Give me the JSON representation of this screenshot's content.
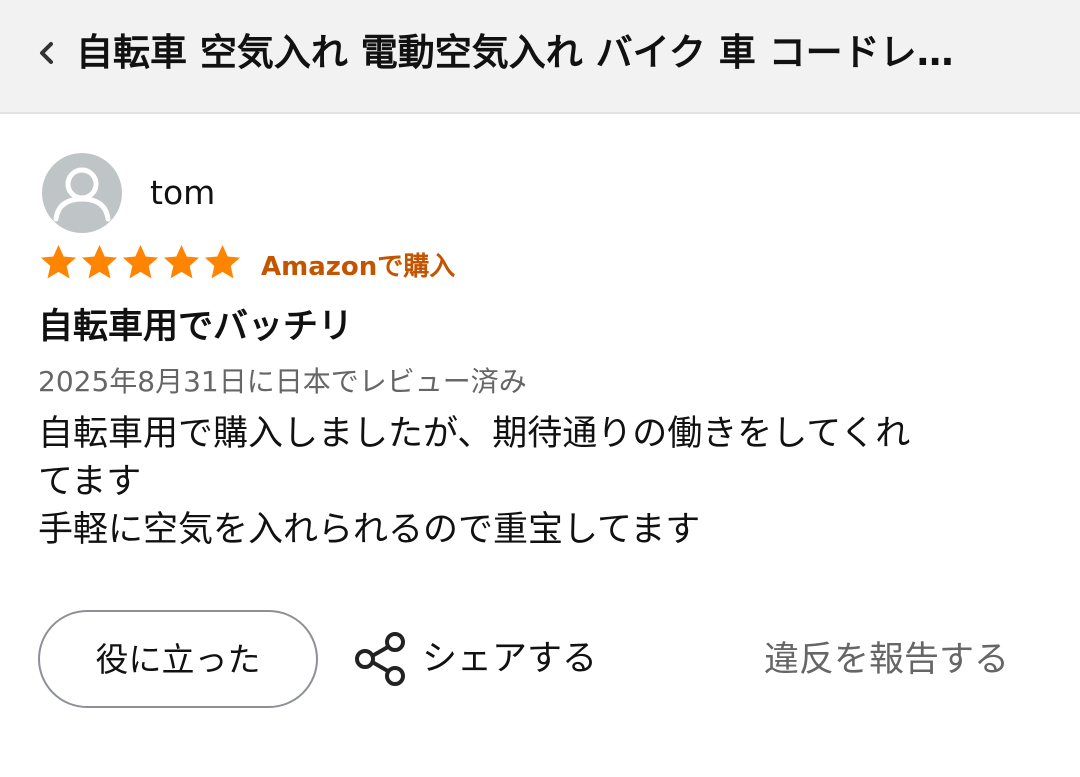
{
  "header": {
    "back_icon": "chevron-left-icon",
    "title": "自転車 空気入れ 電動空気入れ バイク 車 コードレ…"
  },
  "review": {
    "avatar_icon": "user-avatar-icon",
    "reviewer_name": "tom",
    "rating": 5,
    "rating_max": 5,
    "star_color": "#ff8400",
    "verified_label": "Amazonで購入",
    "verified_color": "#c45500",
    "title": "自転車用でバッチリ",
    "date_line": "2025年8月31日に日本でレビュー済み",
    "body_lines": [
      "自転車用で購入しましたが、期待通りの働きをしてくれ",
      "てます",
      "手軽に空気を入れられるので重宝してます"
    ]
  },
  "actions": {
    "helpful_label": "役に立った",
    "share_icon": "share-icon",
    "share_label": "シェアする",
    "report_label": "違反を報告する"
  }
}
